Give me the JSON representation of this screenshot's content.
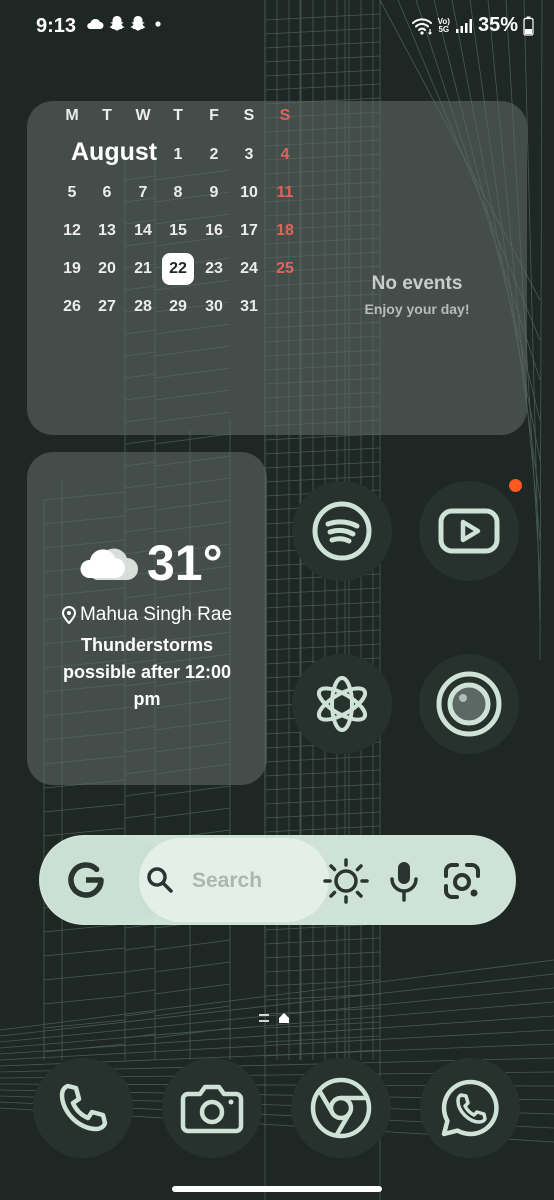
{
  "status_bar": {
    "time": "9:13",
    "left_icons": [
      "cloud-icon",
      "snapchat-icon",
      "snapchat-icon",
      "dot-icon"
    ],
    "right_icons": [
      "wifi-icon",
      "volte-5g-icon",
      "signal-icon",
      "battery-icon"
    ],
    "network_label_top": "Vo)",
    "network_label_bottom": "5G",
    "battery": "35%"
  },
  "calendar": {
    "month": "August",
    "weekdays": [
      "M",
      "T",
      "W",
      "T",
      "F",
      "S",
      "S"
    ],
    "weeks": [
      [
        "",
        "",
        "",
        "1",
        "2",
        "3",
        "4"
      ],
      [
        "5",
        "6",
        "7",
        "8",
        "9",
        "10",
        "11"
      ],
      [
        "12",
        "13",
        "14",
        "15",
        "16",
        "17",
        "18"
      ],
      [
        "19",
        "20",
        "21",
        "22",
        "23",
        "24",
        "25"
      ],
      [
        "26",
        "27",
        "28",
        "29",
        "30",
        "31",
        ""
      ]
    ],
    "today": "22",
    "sunday_color": "#e06458",
    "no_events_title": "No events",
    "no_events_subtitle": "Enjoy your day!"
  },
  "weather": {
    "icon": "partly-cloudy-icon",
    "temperature": "31°",
    "location": "Mahua Singh Rae",
    "description": "Thunderstorms possible after 12:00 pm"
  },
  "apps": [
    {
      "name": "spotify",
      "icon": "spotify-icon"
    },
    {
      "name": "youtube",
      "icon": "youtube-icon",
      "has_notification": true
    },
    {
      "name": "chatgpt",
      "icon": "chatgpt-icon"
    },
    {
      "name": "camera-lens",
      "icon": "lens-icon"
    }
  ],
  "search": {
    "placeholder": "Search",
    "accent": "#cfe2d8",
    "buttons": [
      "google-icon",
      "search-icon",
      "brightness-icon",
      "microphone-icon",
      "google-lens-icon"
    ]
  },
  "page_indicator": {
    "pages": 2,
    "current": 2
  },
  "dock": [
    {
      "name": "phone",
      "icon": "phone-icon"
    },
    {
      "name": "camera",
      "icon": "camera-icon"
    },
    {
      "name": "chrome",
      "icon": "chrome-icon"
    },
    {
      "name": "whatsapp",
      "icon": "whatsapp-icon"
    }
  ],
  "colors": {
    "icon_bg": "#27312e",
    "icon_fg": "#cfe2d8",
    "widget_bg": "rgba(95,104,101,0.60)",
    "notification": "#ff5722"
  }
}
